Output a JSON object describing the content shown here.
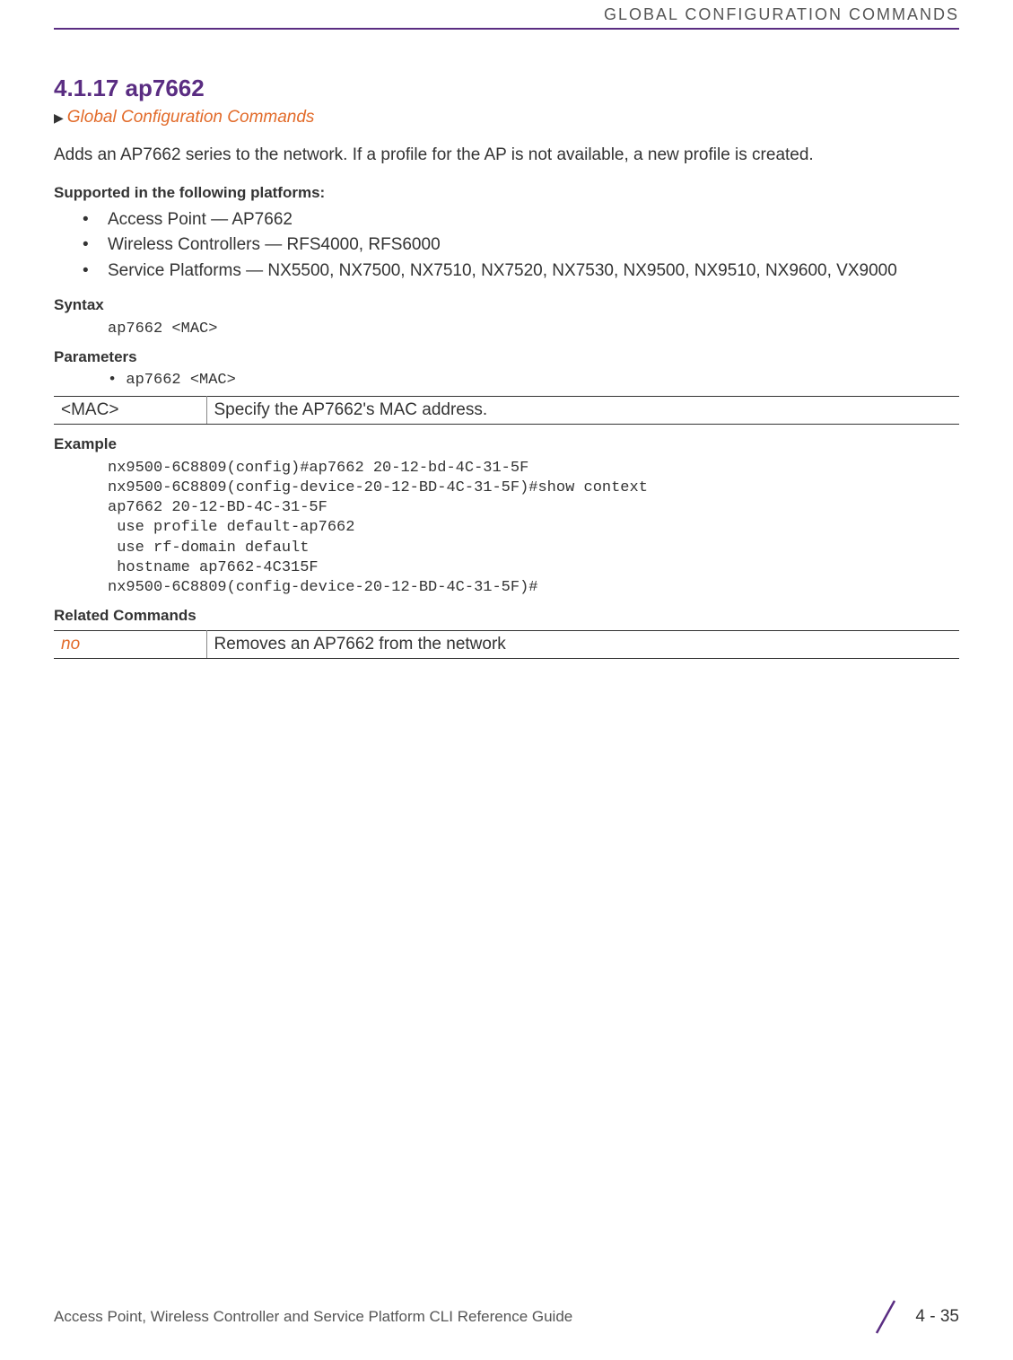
{
  "header": {
    "running_title": "GLOBAL CONFIGURATION COMMANDS"
  },
  "section": {
    "number_title": "4.1.17 ap7662",
    "breadcrumb": "Global Configuration Commands",
    "intro": "Adds an AP7662 series to the network. If a profile for the AP is not available, a new profile is created."
  },
  "platforms": {
    "heading": "Supported in the following platforms:",
    "items": [
      "Access Point — AP7662",
      "Wireless Controllers — RFS4000, RFS6000",
      "Service Platforms — NX5500, NX7500, NX7510, NX7520, NX7530, NX9500, NX9510, NX9600, VX9000"
    ]
  },
  "syntax": {
    "heading": "Syntax",
    "code": "ap7662 <MAC>"
  },
  "parameters": {
    "heading": "Parameters",
    "line": "ap7662 <MAC>",
    "table": {
      "key": "<MAC>",
      "desc": "Specify the AP7662's MAC address."
    }
  },
  "example": {
    "heading": "Example",
    "code": "nx9500-6C8809(config)#ap7662 20-12-bd-4C-31-5F\nnx9500-6C8809(config-device-20-12-BD-4C-31-5F)#show context\nap7662 20-12-BD-4C-31-5F\n use profile default-ap7662\n use rf-domain default\n hostname ap7662-4C315F\nnx9500-6C8809(config-device-20-12-BD-4C-31-5F)#"
  },
  "related": {
    "heading": "Related Commands",
    "table": {
      "key": "no",
      "desc": "Removes an AP7662 from the network"
    }
  },
  "footer": {
    "doc_title": "Access Point, Wireless Controller and Service Platform CLI Reference Guide",
    "page": "4 - 35"
  }
}
